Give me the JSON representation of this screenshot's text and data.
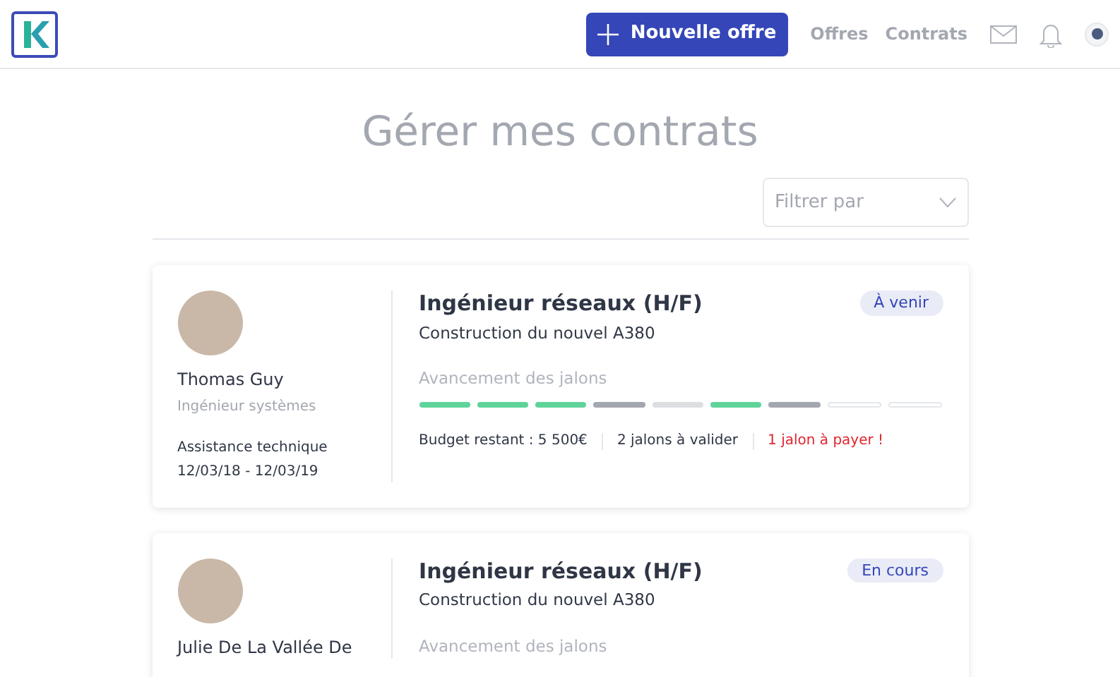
{
  "nav": {
    "new_offer_button": "Nouvelle offre",
    "links": [
      "Offres",
      "Contrats"
    ]
  },
  "page_title": "Gérer mes contrats",
  "filter": {
    "placeholder": "Filtrer par"
  },
  "contracts": [
    {
      "person": "Thomas Guy",
      "role": "Ingénieur systèmes",
      "mission": "Assistance technique",
      "dates": "12/03/18 - 12/03/19",
      "title": "Ingénieur réseaux (H/F)",
      "project": "Construction du nouvel A380",
      "status": "À venir",
      "progress_label": "Avancement des jalons",
      "milestones": [
        {
          "kind": "done"
        },
        {
          "kind": "done"
        },
        {
          "kind": "done"
        },
        {
          "kind": "pending"
        },
        {
          "kind": "planned"
        },
        {
          "kind": "done"
        },
        {
          "kind": "pending"
        },
        {
          "kind": "empty"
        },
        {
          "kind": "empty"
        }
      ],
      "stats": [
        {
          "text": "Budget restant : 5 500€",
          "alert": false
        },
        {
          "text": "2 jalons à valider",
          "alert": false
        },
        {
          "text": "1 jalon à payer !",
          "alert": true
        }
      ]
    },
    {
      "person": "Julie De La Vallée De",
      "title": "Ingénieur réseaux (H/F)",
      "project": "Construction du nouvel A380",
      "status": "En cours",
      "progress_label": "Avancement des jalons"
    }
  ]
}
